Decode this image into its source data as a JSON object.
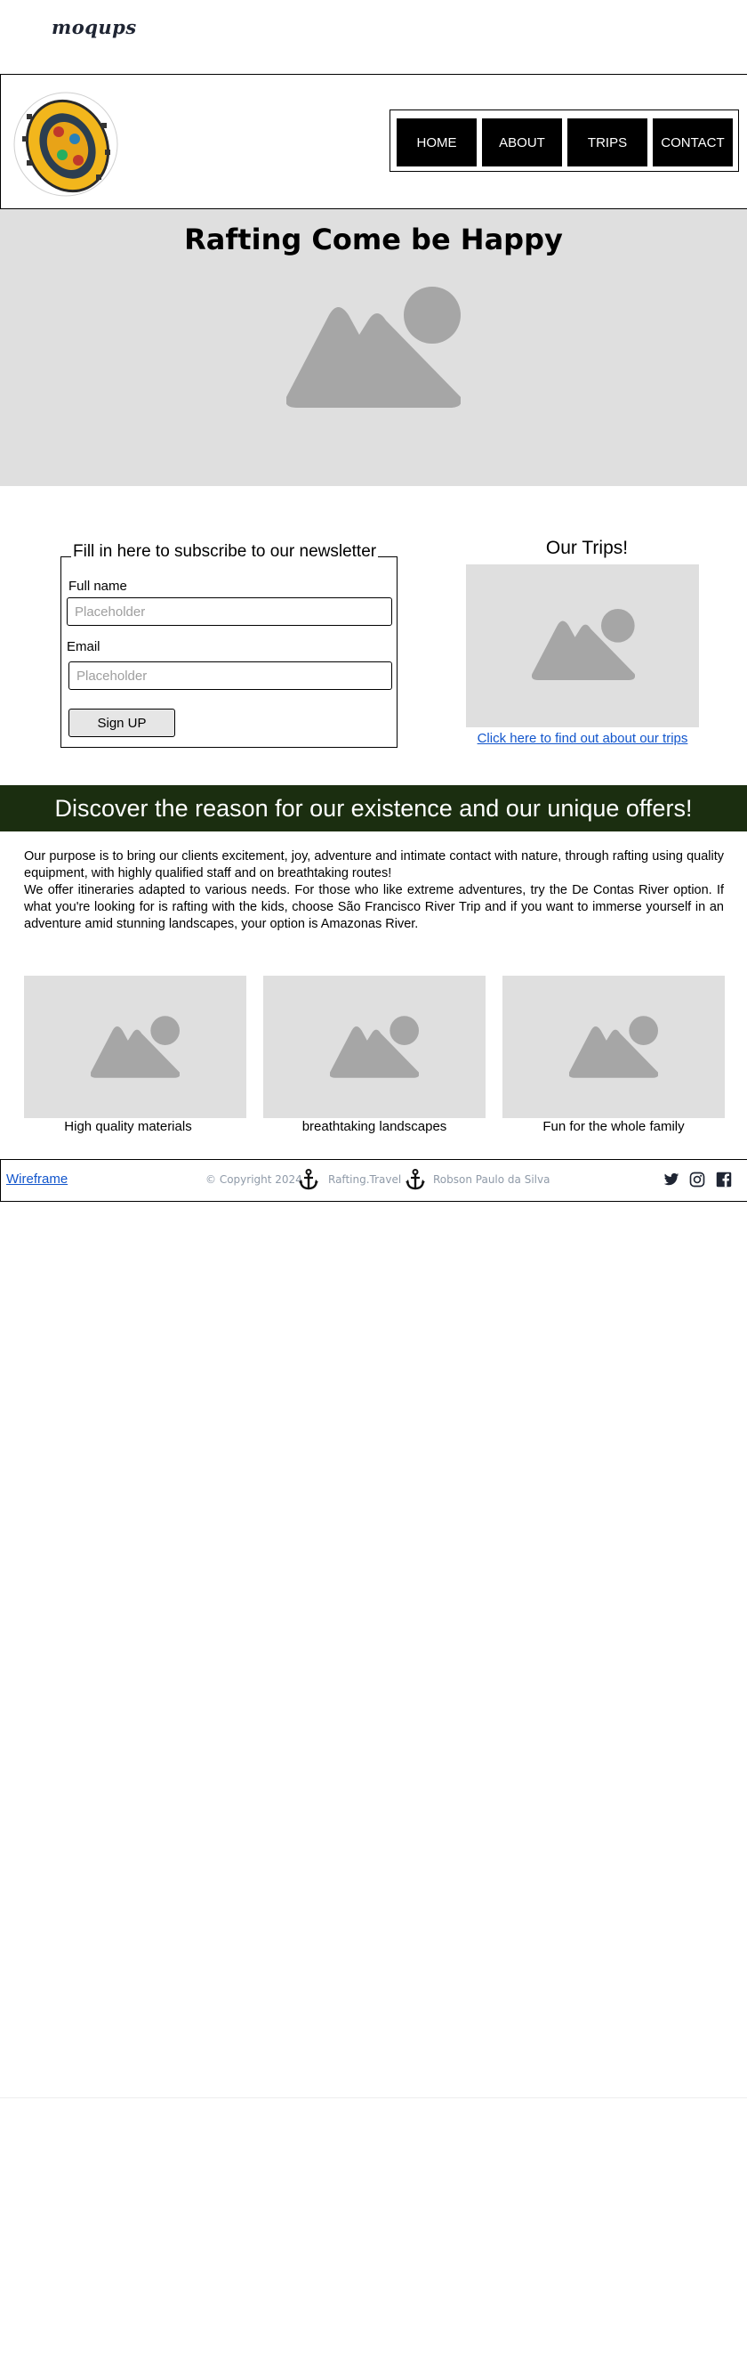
{
  "app": {
    "logo_text": "moqups"
  },
  "header": {
    "nav": [
      "HOME",
      "ABOUT",
      "TRIPS",
      "CONTACT"
    ]
  },
  "hero": {
    "title": "Rafting Come be Happy"
  },
  "newsletter": {
    "legend": "Fill in here to subscribe to our newsletter",
    "fullname_label": "Full name",
    "fullname_placeholder": "Placeholder",
    "email_label": "Email",
    "email_placeholder": "Placeholder",
    "signup_label": "Sign UP"
  },
  "trips": {
    "title": "Our Trips!",
    "link": "Click here to find out about our trips"
  },
  "banner": {
    "text": "Discover the reason for our existence and our unique offers!"
  },
  "about": {
    "p1": "Our purpose is to bring our clients excitement, joy, adventure and intimate contact with nature, through rafting using quality equipment, with highly qualified staff and on breathtaking routes!",
    "p2": "We offer itineraries adapted to various needs. For those who like extreme adventures, try the De Contas River option. If what you're looking for is rafting with the kids, choose São Francisco River Trip and if you want to immerse yourself in an adventure amid stunning landscapes, your option is Amazonas River."
  },
  "features": [
    {
      "caption": "High quality materials"
    },
    {
      "caption": "breathtaking landscapes"
    },
    {
      "caption": "Fun for the whole family"
    }
  ],
  "footer": {
    "link": "Wireframe",
    "copyright": "© Copyright 2024",
    "company": "Rafting.Travel",
    "author": "Robson Paulo da Silva",
    "social_icons": [
      "twitter-icon",
      "instagram-icon",
      "facebook-icon"
    ]
  },
  "colors": {
    "banner_bg": "#1b2e10",
    "nav_bg": "#000000",
    "placeholder_bg": "#dfdfdf",
    "placeholder_shape": "#a6a6a6",
    "link": "#1155cc"
  }
}
